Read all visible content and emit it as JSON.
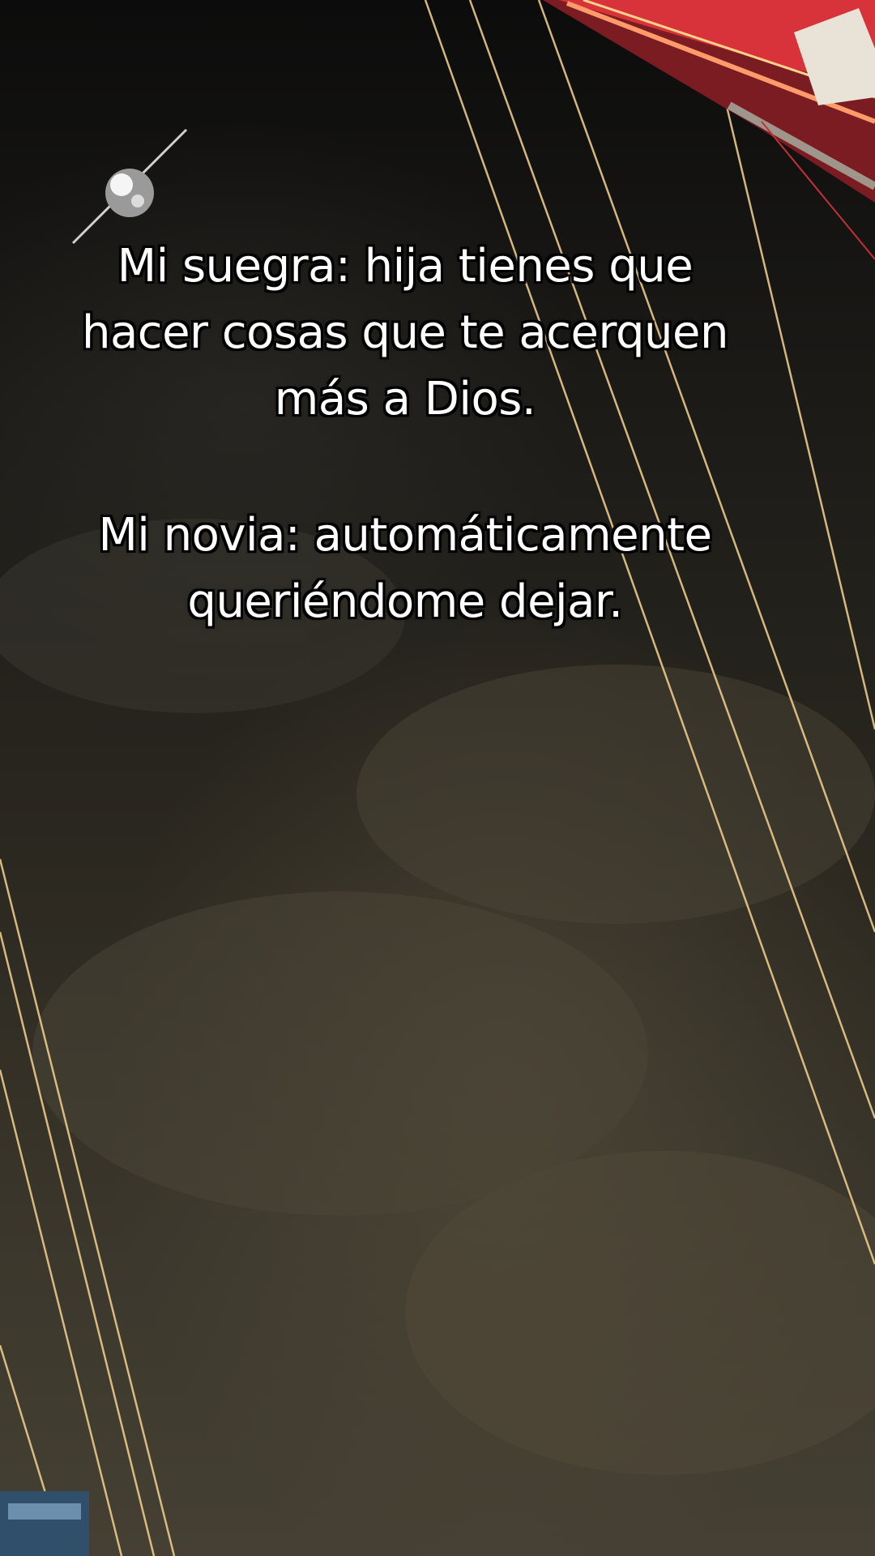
{
  "caption": {
    "block1": {
      "line1": "Mi suegra: hija tienes que",
      "line2": "hacer cosas que te acerquen",
      "line3": "más a Dios."
    },
    "block2": {
      "line1": "Mi novia: automáticamente",
      "line2": "queriéndome dejar."
    }
  },
  "scene": {
    "description_icons": [
      "disco-ball-icon",
      "ride-structure-icon",
      "light-cable-icon"
    ],
    "colors": {
      "caption_text": "#ffffff",
      "caption_outline": "#000000",
      "cable_light": "#e9c98a",
      "ride_red": "#d8323a"
    }
  }
}
